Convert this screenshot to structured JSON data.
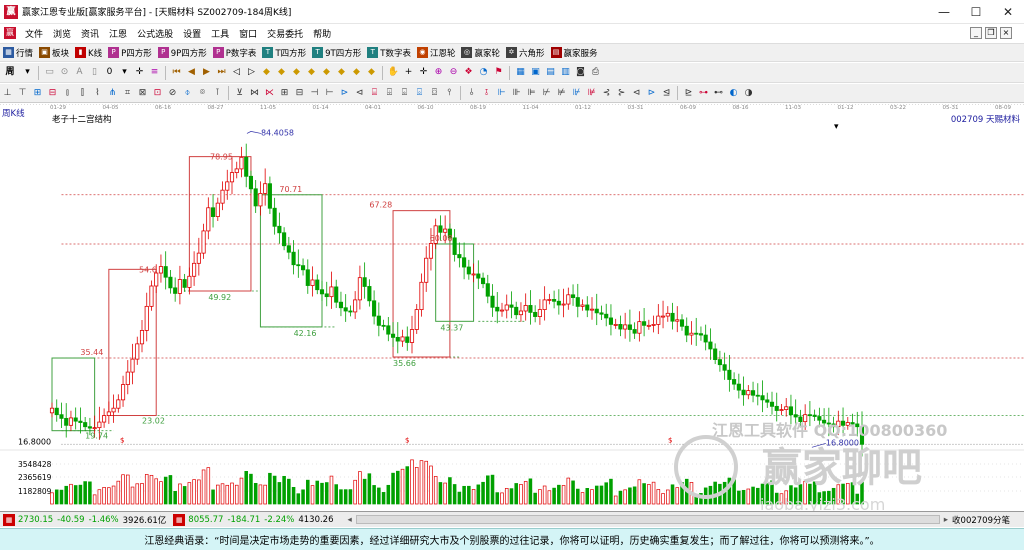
{
  "window": {
    "title": "赢家江恩专业版[赢家服务平台] - [天赐材料  SZ002709-184周K线]",
    "icon": "赢",
    "minimize": "—",
    "maximize": "☐",
    "close": "✕"
  },
  "menu": {
    "items": [
      "文件",
      "浏览",
      "资讯",
      "江恩",
      "公式选股",
      "设置",
      "工具",
      "窗口",
      "交易委托",
      "帮助"
    ]
  },
  "toolbar1": {
    "items": [
      {
        "label": "行情",
        "color": "#2c5aa0",
        "glyph": "▦"
      },
      {
        "label": "板块",
        "color": "#8a4a00",
        "glyph": "▣"
      },
      {
        "label": "K线",
        "color": "#c00000",
        "glyph": "▮"
      },
      {
        "label": "P四方形",
        "color": "#b03090",
        "glyph": "P"
      },
      {
        "label": "9P四方形",
        "color": "#b03090",
        "glyph": "P"
      },
      {
        "label": "P数字表",
        "color": "#b03090",
        "glyph": "P"
      },
      {
        "label": "T四方形",
        "color": "#208080",
        "glyph": "T"
      },
      {
        "label": "9T四方形",
        "color": "#208080",
        "glyph": "T"
      },
      {
        "label": "T数字表",
        "color": "#208080",
        "glyph": "T"
      },
      {
        "label": "江恩轮",
        "color": "#c04000",
        "glyph": "◉"
      },
      {
        "label": "赢家轮",
        "color": "#404040",
        "glyph": "◎"
      },
      {
        "label": "六角形",
        "color": "#404040",
        "glyph": "✡"
      },
      {
        "label": "赢家服务",
        "color": "#a00000",
        "glyph": "▤"
      }
    ]
  },
  "toolbar2": {
    "period": "周"
  },
  "dateaxis": {
    "ticks": [
      "01-29",
      "04-05",
      "06-16",
      "08-27",
      "11-05",
      "01-14",
      "04-01",
      "06-10",
      "08-19",
      "11-04",
      "01-12",
      "03-31",
      "06-09",
      "08-16",
      "11-03",
      "01-12",
      "03-22",
      "05-31",
      "08-09"
    ]
  },
  "chart": {
    "period_label": "周K线",
    "indicator": "老子十二宫结构",
    "symbol": "002709  天赐材料",
    "last_price_label": "16.8000",
    "vol_ticks": [
      "3548428",
      "2365619",
      "1182809"
    ],
    "watermark_text": "江恩工具软件  QQ:100800360",
    "watermark_logo": "赢家聊吧",
    "watermark_url": "iaoba.yizi3.com"
  },
  "chart_data": {
    "type": "candlestick",
    "title": "天赐材料 SZ002709 周K线",
    "ylabels": [
      "84.4058",
      "78.95",
      "70.71",
      "67.28",
      "60.08",
      "54.6",
      "49.92",
      "43.37",
      "42.16",
      "35.66",
      "35.44",
      "23.02",
      "19.74",
      "16.8000"
    ],
    "price_levels": {
      "high": 84.4058,
      "last": 16.8,
      "red_lines": [
        70.71,
        60.08,
        35.44
      ],
      "green_lines": [
        49.92,
        42.16,
        23.02,
        19.74,
        43.37,
        35.66
      ]
    },
    "boxes": [
      {
        "color": "green",
        "top": 35.44,
        "bottom": 19.74
      },
      {
        "color": "red",
        "top": 54.6,
        "bottom": 23.02
      },
      {
        "color": "red",
        "top": 78.95,
        "bottom": 49.92
      },
      {
        "color": "green",
        "top": 70.71,
        "bottom": 42.16
      },
      {
        "color": "red",
        "top": 67.28,
        "bottom": 35.66
      },
      {
        "color": "green",
        "top": 60.08,
        "bottom": 43.37
      }
    ],
    "weekly_close": [
      24.6,
      23.2,
      22.4,
      20.9,
      22.5,
      21.8,
      21.5,
      20.6,
      20.3,
      20.4,
      21.6,
      23,
      23.8,
      24.6,
      26.4,
      29.7,
      32.4,
      35.2,
      38.5,
      41.4,
      46.6,
      51,
      53.8,
      55.2,
      52.9,
      50.6,
      49.4,
      52.4,
      50.7,
      53.1,
      55.9,
      58.1,
      62.9,
      67.9,
      66,
      68.9,
      71.7,
      73.5,
      75.5,
      76.3,
      78.8,
      74.7,
      72,
      68.3,
      71,
      73.1,
      67.8,
      63.9,
      62.5,
      59.7,
      58.3,
      55.6,
      55.4,
      54.5,
      51.1,
      52.3,
      50.2,
      49.3,
      48.7,
      50.8,
      47.5,
      46.3,
      45.6,
      45.4,
      48,
      52.8,
      50.9,
      47.8,
      44.5,
      42.5,
      42.4,
      40.6,
      39.9,
      39.1,
      40,
      38.8,
      41.6,
      45.9,
      51.8,
      57,
      60.2,
      64,
      62.6,
      63.3,
      61.4,
      57.8,
      57.1,
      55.1,
      53.6,
      53.6,
      52.7,
      51.5,
      48.8,
      46.4,
      45.6,
      45.8,
      46.9,
      46.4,
      44.8,
      45.6,
      46.8,
      45.3,
      44.4,
      45.9,
      48,
      48.1,
      47.7,
      46.9,
      47.1,
      49.1,
      48.5,
      46.6,
      46.9,
      45.8,
      46,
      45.2,
      44.9,
      44.1,
      42.7,
      42.7,
      41.7,
      42.6,
      41.6,
      40.8,
      43.3,
      42.5,
      42.5,
      42.7,
      44.5,
      44.5,
      45.1,
      43.4,
      43.7,
      42.3,
      40.4,
      40.8,
      40.7,
      40.4,
      38.9,
      37.4,
      35.1,
      34,
      32.8,
      30.8,
      29.8,
      28.5,
      27.5,
      28.4,
      27.4,
      27.3,
      26.4,
      25.9,
      25,
      24.1,
      24.3,
      24.9,
      23.2,
      22.7,
      21.7,
      23.2,
      23.1,
      22.8,
      22,
      21.4,
      21.2,
      20.6,
      21.8,
      20.9,
      21.5,
      21.2,
      20.6,
      16.8
    ],
    "xlabel": "",
    "ylabel": ""
  },
  "status": {
    "sh": "2730.15",
    "sh_chg": "-40.59",
    "sh_pct": "-1.46%",
    "sh_amt": "3926.61亿",
    "sz": "8055.77",
    "sz_chg": "-184.71",
    "sz_pct": "-2.24%",
    "sz_amt": "4130.26",
    "right": "收002709分笔"
  },
  "quote": "江恩经典语录：“时间是决定市场走势的重要因素，经过详细研究大市及个别股票的过往记录，你将可以证明，历史确实重复发生；而了解过往，你将可以预测将来。”。",
  "colors": {
    "up": "#e00000",
    "down": "#00a000",
    "box_red": "#d04040",
    "box_green": "#40a040",
    "high_marker": "#3333aa"
  }
}
